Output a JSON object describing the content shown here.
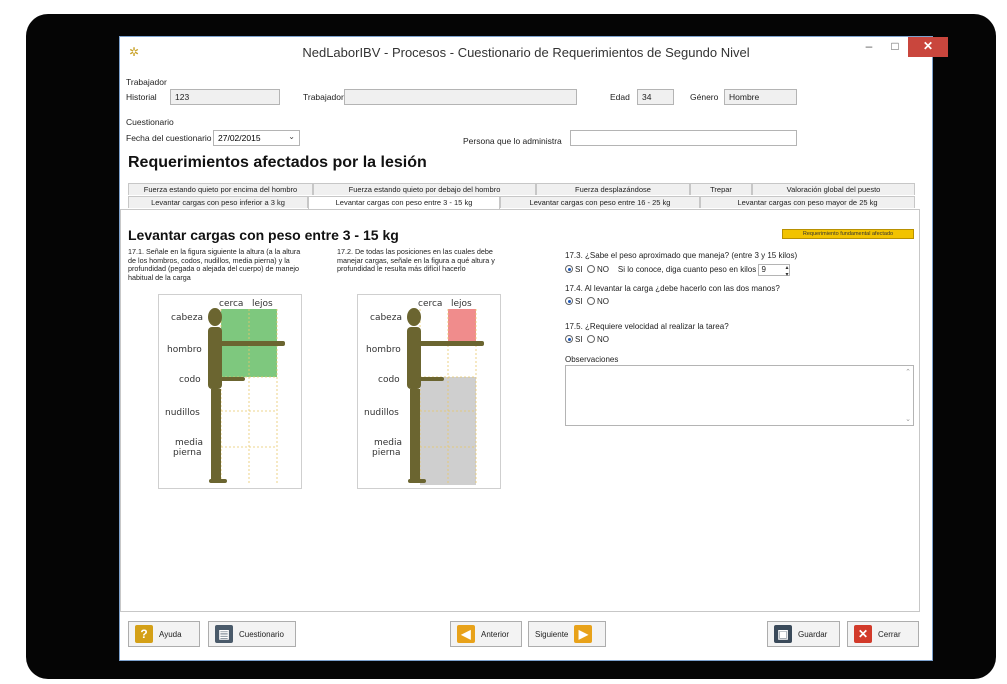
{
  "window": {
    "title": "NedLaborIBV - Procesos - Cuestionario de Requerimientos de Segundo Nivel",
    "minimize": "–",
    "maximize": "□",
    "close": "✕"
  },
  "trabajador": {
    "group_label": "Trabajador",
    "historial_label": "Historial",
    "historial_value": "123",
    "trabajador_label": "Trabajador",
    "trabajador_value": "",
    "edad_label": "Edad",
    "edad_value": "34",
    "genero_label": "Género",
    "genero_value": "Hombre"
  },
  "cuestionario": {
    "group_label": "Cuestionario",
    "fecha_label": "Fecha del cuestionario",
    "fecha_value": "27/02/2015",
    "persona_label": "Persona que lo administra",
    "persona_value": ""
  },
  "section_title": "Requerimientos afectados por la lesión",
  "tabs_row1": [
    "Fuerza estando quieto por encima del hombro",
    "Fuerza estando quieto por debajo del hombro",
    "Fuerza desplazándose",
    "Trepar",
    "Valoración global del puesto"
  ],
  "tabs_row2": [
    "Levantar cargas con peso inferior a 3 kg",
    "Levantar cargas con peso entre 3 - 15 kg",
    "Levantar cargas con peso entre 16 - 25 kg",
    "Levantar cargas con peso mayor de 25 kg"
  ],
  "panel": {
    "title": "Levantar cargas con peso entre 3 - 15 kg",
    "badge": "Requerimiento fundamental afectado",
    "q1": "17.1. Señale en la figura siguiente la altura (a la altura de los hombros, codos, nudillos, media pierna) y la profundidad (pegada o alejada del cuerpo) de manejo habitual de la carga",
    "q2": "17.2. De todas las posiciones en las cuales debe manejar cargas, señale en la figura a qué altura y profundidad le resulta más difícil hacerlo",
    "figure": {
      "near": "cerca",
      "far": "lejos",
      "levels": [
        "cabeza",
        "hombro",
        "codo",
        "nudillos",
        "media",
        "pierna"
      ]
    },
    "q3": "17.3. ¿Sabe el peso aproximado que maneja? (entre 3 y 15 kilos)",
    "q3_yes": "SI",
    "q3_no": "NO",
    "q3_hint": "Si lo conoce, diga cuanto peso en kilos",
    "q3_kilos": "9",
    "q4": "17.4. Al levantar la carga ¿debe hacerlo con las dos manos?",
    "q4_yes": "SI",
    "q4_no": "NO",
    "q5": "17.5. ¿Requiere velocidad al realizar la tarea?",
    "q5_yes": "SI",
    "q5_no": "NO",
    "obs_label": "Observaciones"
  },
  "buttons": {
    "ayuda": "Ayuda",
    "cuestionario": "Cuestionario",
    "anterior": "Anterior",
    "siguiente": "Siguiente",
    "guardar": "Guardar",
    "cerrar": "Cerrar"
  },
  "colors": {
    "fig1_highlight": "#7ec87e",
    "fig2_highlight": "#f08c8c",
    "fig2_gray": "#cfcfcf",
    "badge": "#f2c300"
  }
}
